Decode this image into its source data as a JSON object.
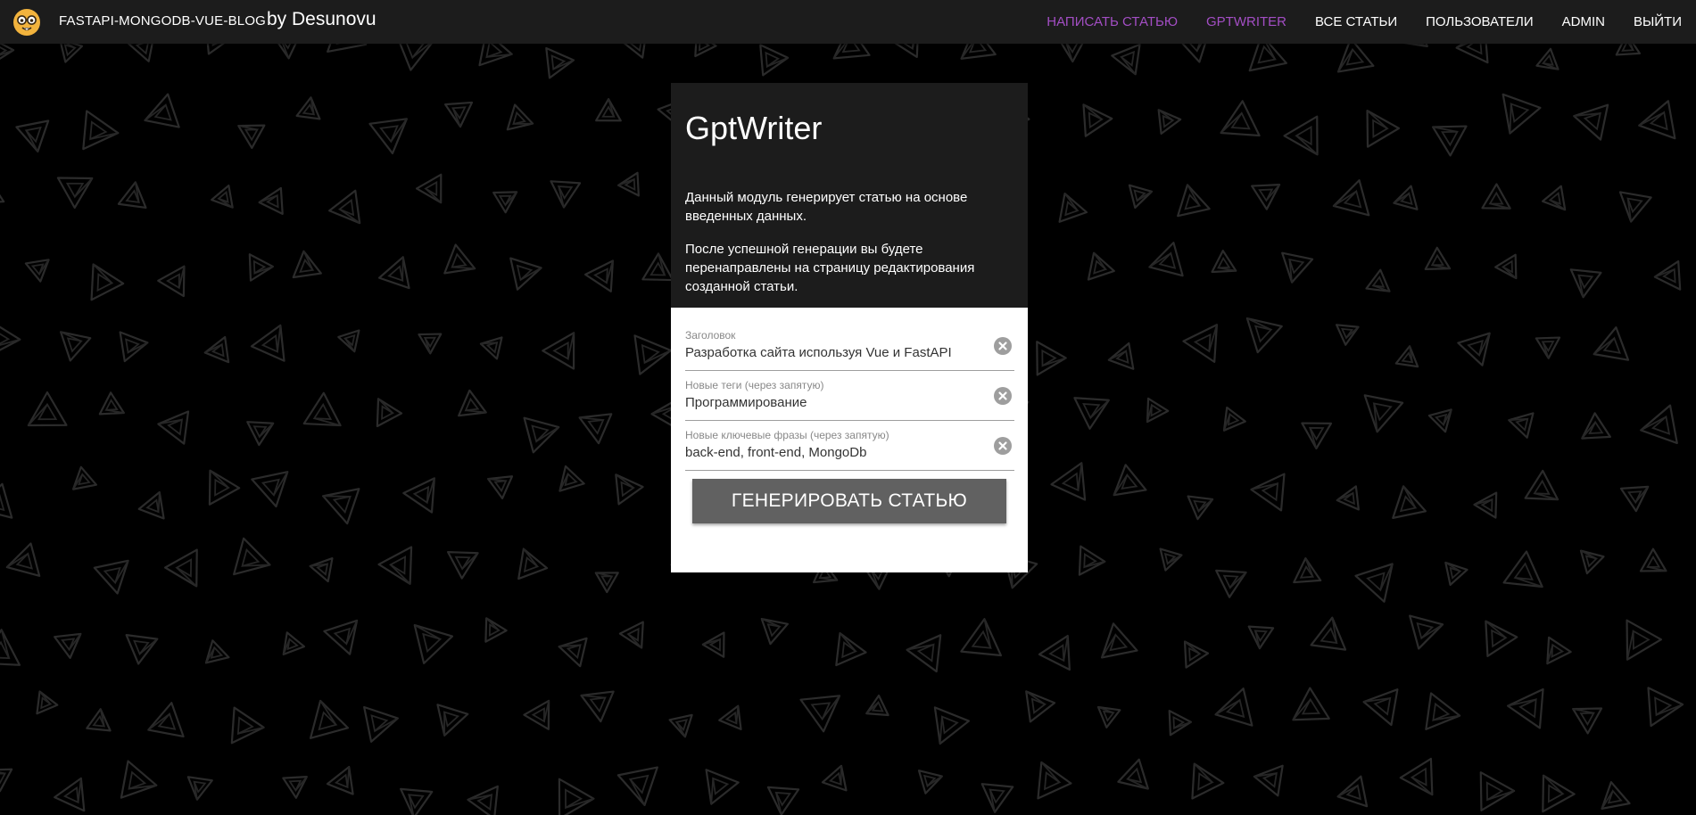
{
  "header": {
    "brand": "FASTAPI-MONGODB-VUE-BLOG",
    "byline": "by Desunovu",
    "logo_icon": "nerd-face-icon",
    "nav": [
      {
        "label": "НАПИСАТЬ СТАТЬЮ",
        "color": "#a34ec4"
      },
      {
        "label": "GPTWRITER",
        "color": "#a34ec4"
      },
      {
        "label": "ВСЕ СТАТЬИ",
        "color": "#ffffff"
      },
      {
        "label": "ПОЛЬЗОВАТЕЛИ",
        "color": "#ffffff"
      },
      {
        "label": "ADMIN",
        "color": "#ffffff"
      },
      {
        "label": "ВЫЙТИ",
        "color": "#ffffff"
      }
    ]
  },
  "card": {
    "title": "GptWriter",
    "desc1": "Данный модуль генерирует статью на основе введенных данных.",
    "desc2": "После успешной генерации вы будете перенаправлены на страницу редактирования созданной статьи.",
    "fields": [
      {
        "label": "Заголовок",
        "value": "Разработка сайта используя Vue и FastAPI"
      },
      {
        "label": "Новые теги (через запятую)",
        "value": "Программирование"
      },
      {
        "label": "Новые ключевые фразы (через запятую)",
        "value": "back-end, front-end, MongoDb"
      }
    ],
    "button": "ГЕНЕРИРОВАТЬ СТАТЬЮ"
  },
  "colors": {
    "background": "#000000",
    "topbar": "#1c1c1c",
    "accent": "#a34ec4",
    "button": "#616161"
  }
}
